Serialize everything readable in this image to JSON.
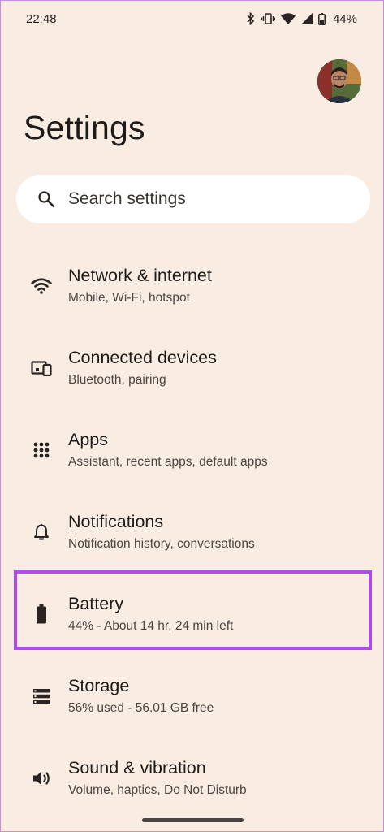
{
  "status_bar": {
    "time": "22:48",
    "battery_percent": "44%",
    "icons": [
      "bluetooth-icon",
      "vibrate-icon",
      "wifi-icon",
      "signal-icon",
      "battery-icon"
    ]
  },
  "header": {
    "title": "Settings"
  },
  "search": {
    "placeholder": "Search settings"
  },
  "settings_items": [
    {
      "icon": "wifi-icon",
      "title": "Network & internet",
      "subtitle": "Mobile, Wi-Fi, hotspot"
    },
    {
      "icon": "devices-icon",
      "title": "Connected devices",
      "subtitle": "Bluetooth, pairing"
    },
    {
      "icon": "apps-grid-icon",
      "title": "Apps",
      "subtitle": "Assistant, recent apps, default apps"
    },
    {
      "icon": "bell-icon",
      "title": "Notifications",
      "subtitle": "Notification history, conversations"
    },
    {
      "icon": "battery-icon",
      "title": "Battery",
      "subtitle": "44% - About 14 hr, 24 min left"
    },
    {
      "icon": "storage-icon",
      "title": "Storage",
      "subtitle": "56% used - 56.01 GB free"
    },
    {
      "icon": "speaker-icon",
      "title": "Sound & vibration",
      "subtitle": "Volume, haptics, Do Not Disturb"
    }
  ],
  "colors": {
    "background": "#f9ece3",
    "highlight": "#b14be8",
    "search_bg": "#ffffff"
  }
}
